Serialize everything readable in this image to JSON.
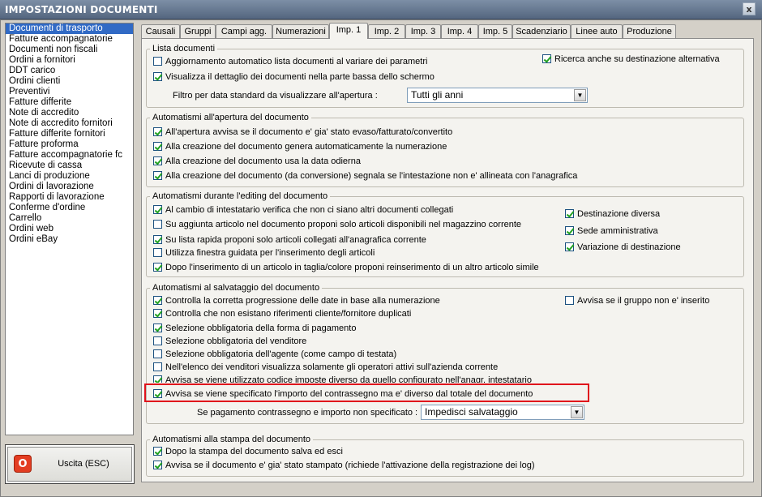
{
  "window": {
    "title": "IMPOSTAZIONI DOCUMENTI",
    "close_glyph": "x"
  },
  "sidebar": {
    "items": [
      {
        "label": "Documenti di trasporto",
        "selected": true
      },
      {
        "label": "Fatture accompagnatorie"
      },
      {
        "label": "Documenti non fiscali"
      },
      {
        "label": "Ordini a fornitori"
      },
      {
        "label": "DDT carico"
      },
      {
        "label": "Ordini clienti"
      },
      {
        "label": "Preventivi"
      },
      {
        "label": "Fatture differite"
      },
      {
        "label": "Note di accredito"
      },
      {
        "label": "Note di accredito fornitori"
      },
      {
        "label": "Fatture differite fornitori"
      },
      {
        "label": "Fatture proforma"
      },
      {
        "label": "Fatture accompagnatorie fc"
      },
      {
        "label": "Ricevute di cassa"
      },
      {
        "label": "Lanci di produzione"
      },
      {
        "label": "Ordini di lavorazione"
      },
      {
        "label": "Rapporti di lavorazione"
      },
      {
        "label": "Conferme d'ordine"
      },
      {
        "label": "Carrello"
      },
      {
        "label": "Ordini web"
      },
      {
        "label": "Ordini eBay"
      }
    ]
  },
  "exit_button": {
    "label": "Uscita (ESC)",
    "icon": "power-icon",
    "icon_glyph": "O"
  },
  "tabs": [
    {
      "label": "Causali"
    },
    {
      "label": "Gruppi"
    },
    {
      "label": "Campi agg."
    },
    {
      "label": "Numerazioni"
    },
    {
      "label": "Imp. 1",
      "active": true
    },
    {
      "label": "Imp. 2"
    },
    {
      "label": "Imp. 3"
    },
    {
      "label": "Imp. 4"
    },
    {
      "label": "Imp. 5"
    },
    {
      "label": "Scadenziario"
    },
    {
      "label": "Linee auto"
    },
    {
      "label": "Produzione"
    }
  ],
  "groups": {
    "lista": {
      "title": "Lista documenti",
      "options": [
        {
          "label": "Aggiornamento automatico lista documenti al variare dei parametri",
          "checked": false
        },
        {
          "label": "Visualizza il dettaglio dei documenti nella parte bassa dello schermo",
          "checked": true
        },
        {
          "label": "Ricerca anche su destinazione alternativa",
          "checked": true
        }
      ],
      "filter_label": "Filtro per data standard da visualizzare all'apertura :",
      "filter_value": "Tutti gli anni"
    },
    "apertura": {
      "title": "Automatismi all'apertura del documento",
      "options": [
        {
          "label": "All'apertura avvisa se il documento e' gia' stato evaso/fatturato/convertito",
          "checked": true
        },
        {
          "label": "Alla creazione del documento genera automaticamente la numerazione",
          "checked": true
        },
        {
          "label": "Alla creazione del documento usa la data odierna",
          "checked": true
        },
        {
          "label": "Alla creazione del documento (da conversione) segnala se l'intestazione non e' allineata con l'anagrafica",
          "checked": true
        }
      ]
    },
    "editing": {
      "title": "Automatismi durante l'editing del documento",
      "options": [
        {
          "label": "Al cambio di intestatario verifica che non ci siano altri documenti collegati",
          "checked": true
        },
        {
          "label": "Su aggiunta articolo nel documento proponi solo articoli disponibili nel magazzino corrente",
          "checked": false
        },
        {
          "label": "Su lista rapida proponi solo articoli collegati all'anagrafica corrente",
          "checked": true
        },
        {
          "label": "Utilizza finestra guidata per l'inserimento degli articoli",
          "checked": false
        },
        {
          "label": "Dopo l'inserimento di un articolo in taglia/colore proponi reinserimento di un altro articolo simile",
          "checked": true
        },
        {
          "label": "Destinazione diversa",
          "checked": true
        },
        {
          "label": "Sede amministrativa",
          "checked": true
        },
        {
          "label": "Variazione di destinazione",
          "checked": true
        }
      ]
    },
    "salvataggio": {
      "title": "Automatismi al salvataggio del documento",
      "options": [
        {
          "label": "Controlla la corretta progressione delle date in base alla numerazione",
          "checked": true
        },
        {
          "label": "Controlla che non esistano riferimenti cliente/fornitore duplicati",
          "checked": true
        },
        {
          "label": "Selezione obbligatoria della forma di pagamento",
          "checked": true
        },
        {
          "label": "Selezione obbligatoria del venditore",
          "checked": false
        },
        {
          "label": "Selezione obbligatoria dell'agente (come campo di testata)",
          "checked": false
        },
        {
          "label": "Nell'elenco dei venditori visualizza solamente gli operatori attivi sull'azienda corrente",
          "checked": false
        },
        {
          "label": "Avvisa se viene utilizzato codice imposte diverso da quello configurato nell'anagr. intestatario",
          "checked": true
        },
        {
          "label": "Avvisa se viene specificato l'importo del contrassegno ma e' diverso dal totale del documento",
          "checked": true
        },
        {
          "label": "Avvisa se il gruppo non e' inserito",
          "checked": false
        }
      ],
      "contrassegno_label": "Se pagamento contrassegno e importo non specificato :",
      "contrassegno_value": "Impedisci salvataggio"
    },
    "stampa": {
      "title": "Automatismi alla stampa del documento",
      "options": [
        {
          "label": "Dopo la stampa del documento salva ed esci",
          "checked": true
        },
        {
          "label": "Avvisa se il documento e' gia' stato stampato (richiede l'attivazione della registrazione dei log)",
          "checked": true
        }
      ]
    }
  },
  "colors": {
    "highlight": "#e0121c",
    "selection": "#316ac5",
    "check": "#21a121"
  }
}
